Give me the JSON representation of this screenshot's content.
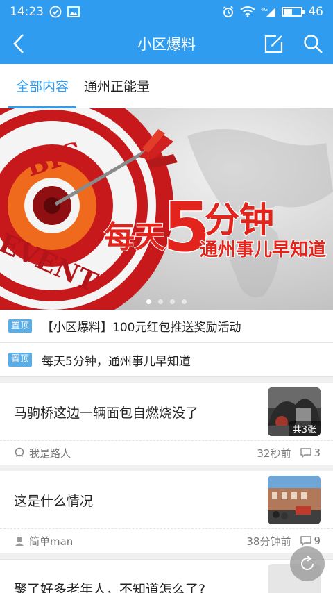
{
  "status": {
    "time": "14:23",
    "network": "4G",
    "battery": "46",
    "battery_level": 0.46
  },
  "navbar": {
    "title": "小区爆料",
    "back_icon": "back-chevron-icon",
    "compose_icon": "compose-icon",
    "search_icon": "search-icon"
  },
  "tabs": [
    {
      "label": "全部内容",
      "active": true
    },
    {
      "label": "通州正能量",
      "active": false
    }
  ],
  "banner": {
    "big": "BIG",
    "event": "EVENT",
    "headline_prefix": "每天",
    "headline_number": "5",
    "headline_suffix": "分钟",
    "subline": "通州事儿早知道",
    "slide_count": 4,
    "active_slide": 0
  },
  "pinned": [
    {
      "badge": "置顶",
      "text": "【小区爆料】100元红包推送奖励活动"
    },
    {
      "badge": "置顶",
      "text": "每天5分钟，通州事儿早知道"
    }
  ],
  "posts": [
    {
      "title": "马驹桥这边一辆面包自燃烧没了",
      "author": "我是路人",
      "time": "32秒前",
      "comments": "3",
      "photo_count": "共3张"
    },
    {
      "title": "这是什么情况",
      "author": "简单man",
      "time": "38分钟前",
      "comments": "9"
    },
    {
      "title": "聚了好多老年人，不知道怎么了?"
    }
  ],
  "colors": {
    "accent": "#2f9cf0",
    "badge": "#5aaee8"
  }
}
